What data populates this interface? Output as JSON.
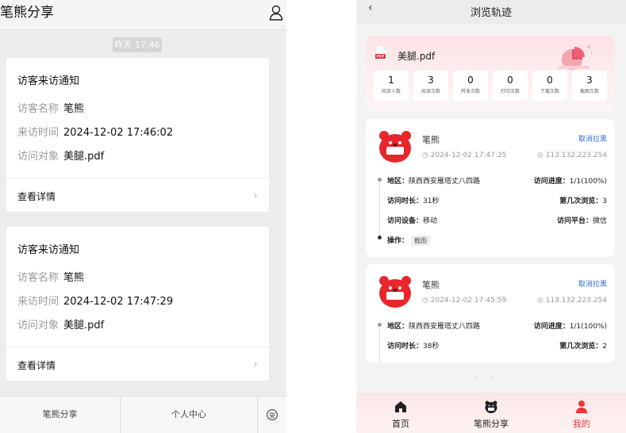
{
  "left": {
    "title": "笔熊分享",
    "timestamp": "昨天 17:46",
    "notices": [
      {
        "title": "访客来访通知",
        "rows": [
          {
            "key": "访客名称",
            "value": "笔熊"
          },
          {
            "key": "来访时间",
            "value": "2024-12-02 17:46:02"
          },
          {
            "key": "访问对象",
            "value": "美腿.pdf"
          }
        ],
        "detail": "查看详情"
      },
      {
        "title": "访客来访通知",
        "rows": [
          {
            "key": "访客名称",
            "value": "笔熊"
          },
          {
            "key": "来访时间",
            "value": "2024-12-02 17:47:29"
          },
          {
            "key": "访问对象",
            "value": "美腿.pdf"
          }
        ],
        "detail": "查看详情"
      }
    ],
    "tabbar": [
      "笔熊分享",
      "个人中心"
    ]
  },
  "right": {
    "title": "浏览轨迹",
    "file": "美腿.pdf",
    "stats": [
      {
        "value": "1",
        "label": "阅读人数"
      },
      {
        "value": "3",
        "label": "阅读次数"
      },
      {
        "value": "0",
        "label": "转发次数"
      },
      {
        "value": "0",
        "label": "打印次数"
      },
      {
        "value": "0",
        "label": "下载次数"
      },
      {
        "value": "3",
        "label": "截图次数"
      }
    ],
    "visits": [
      {
        "name": "笔熊",
        "action": "取消拉黑",
        "time": "2024-12-02 17:47:25",
        "ip": "113.132.223.254",
        "region_label": "地区：",
        "region": "陕西西安雁塔丈八四路",
        "progress_label": "访问进度：",
        "progress": "1/1(100%)",
        "duration_label": "访问时长：",
        "duration": "31秒",
        "nth_label": "第几次浏览：",
        "nth": "3",
        "device_label": "访问设备：",
        "device": "移动",
        "platform_label": "访问平台：",
        "platform": "微信",
        "op_label": "操作：",
        "op": "截图"
      },
      {
        "name": "笔熊",
        "action": "取消拉黑",
        "time": "2024-12-02 17:45:59",
        "ip": "113.132.223.254",
        "region_label": "地区：",
        "region": "陕西西安雁塔丈八四路",
        "progress_label": "访问进度：",
        "progress": "1/1(100%)",
        "duration_label": "访问时长：",
        "duration": "38秒",
        "nth_label": "第几次浏览：",
        "nth": "2"
      }
    ],
    "tabbar": [
      {
        "label": "首页",
        "icon": "home-icon"
      },
      {
        "label": "笔熊分享",
        "icon": "bear-icon"
      },
      {
        "label": "我的",
        "icon": "user-icon"
      }
    ],
    "active_tab": "我的",
    "colors": {
      "accent": "#e83a3a",
      "link": "#2f6fd6",
      "brand_red": "#e8262c"
    }
  }
}
